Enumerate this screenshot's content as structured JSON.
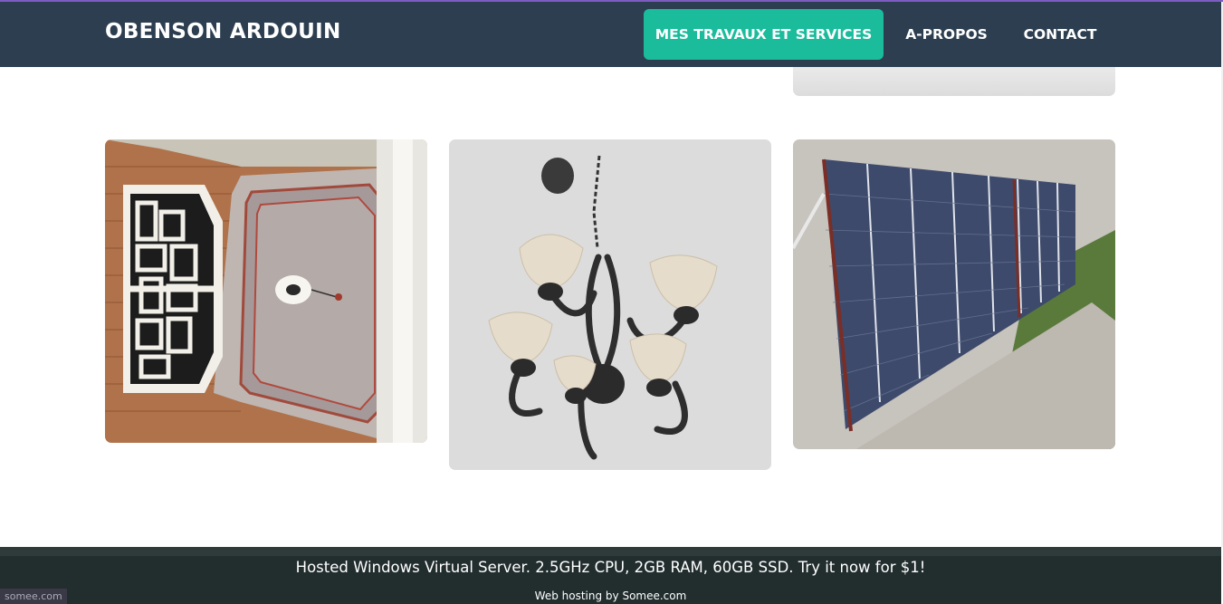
{
  "brand": "OBENSON ARDOUIN",
  "nav": {
    "services": "MES TRAVAUX ET SERVICES",
    "about": "A-PROPOS",
    "contact": "CONTACT"
  },
  "gallery": [
    {
      "subject": "vaulted ceiling with round light fixture and decorative window grille"
    },
    {
      "subject": "wrought iron chandelier with five glass shades"
    },
    {
      "subject": "row of solar panels mounted on a concrete roof"
    }
  ],
  "footer": {
    "promo": "Hosted Windows Virtual Server. 2.5GHz CPU, 2GB RAM, 60GB SSD. Try it now for $1!",
    "hosting": "Web hosting by Somee.com",
    "badge": "somee.com"
  },
  "colors": {
    "navbar": "#2c3e50",
    "accent": "#1abc9c",
    "footer": "#222d2e"
  }
}
